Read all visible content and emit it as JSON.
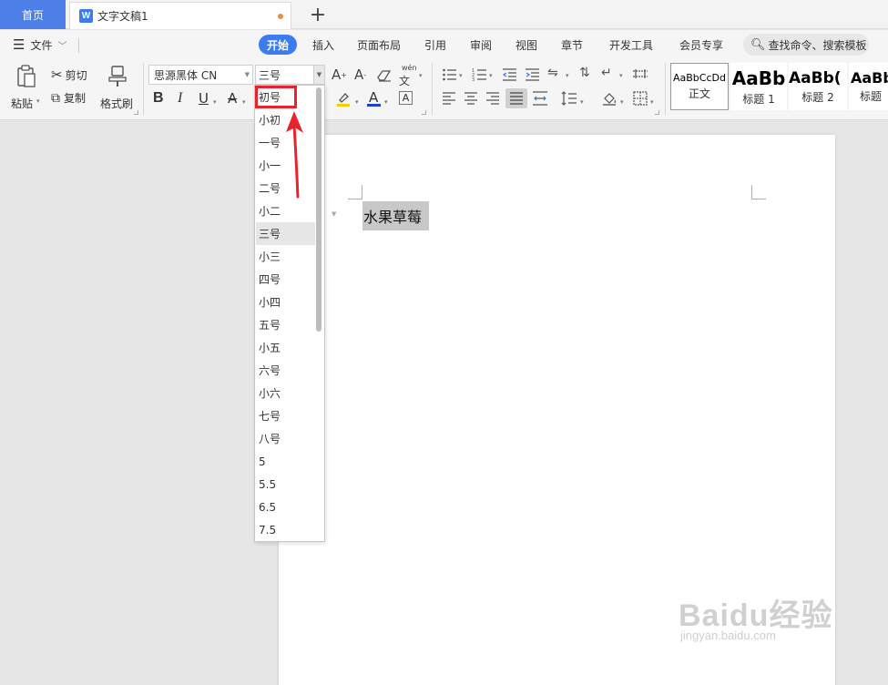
{
  "titlebar": {
    "home_tab": "首页",
    "doc_tab": "文字文稿1",
    "doc_icon": "W",
    "add_tab": "+"
  },
  "menubar": {
    "file": "文件",
    "tabs": [
      "开始",
      "插入",
      "页面布局",
      "引用",
      "审阅",
      "视图",
      "章节",
      "开发工具",
      "会员专享"
    ],
    "active_tab": "开始",
    "search_placeholder": "查找命令、搜索模板"
  },
  "ribbon": {
    "paste": "粘贴",
    "cut": "剪切",
    "copy": "复制",
    "format_painter": "格式刷",
    "font_name": "思源黑体 CN",
    "font_size": "三号",
    "styles": [
      {
        "sample": "AaBbCcDd",
        "label": "正文"
      },
      {
        "sample": "AaBb",
        "label": "标题 1"
      },
      {
        "sample": "AaBb(",
        "label": "标题 2"
      },
      {
        "sample": "AaBb",
        "label": "标题"
      }
    ]
  },
  "font_size_dropdown": {
    "items": [
      "初号",
      "小初",
      "一号",
      "小一",
      "二号",
      "小二",
      "三号",
      "小三",
      "四号",
      "小四",
      "五号",
      "小五",
      "六号",
      "小六",
      "七号",
      "八号",
      "5",
      "5.5",
      "6.5",
      "7.5"
    ],
    "selected": "三号",
    "highlighted": "初号"
  },
  "document": {
    "selected_text": "水果草莓"
  },
  "watermark": {
    "logo": "Baidu经验",
    "url": "jingyan.baidu.com"
  },
  "colors": {
    "accent_blue": "#3c7cf0",
    "highlight_red": "#e8232b"
  }
}
